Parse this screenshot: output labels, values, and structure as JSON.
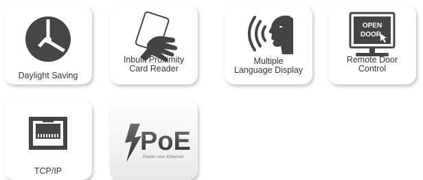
{
  "features": [
    {
      "label": "Daylight Saving",
      "icon": "clock-icon"
    },
    {
      "label": "Inbuilt Proximity\nCard Reader",
      "icon": "hand-card-icon"
    },
    {
      "label": "Multiple\nLanguage Display",
      "icon": "speaking-head-icon"
    },
    {
      "label": "Remote Door\nControl",
      "icon": "monitor-icon"
    },
    {
      "label": "TCP/IP",
      "icon": "ethernet-port-icon"
    },
    {
      "label": "",
      "icon": "poe-logo-icon"
    }
  ],
  "remote_screen_text": [
    "OPEN",
    "DOOR"
  ],
  "poe_logo": {
    "text": "PoE",
    "tagline": "Power over Ethernet"
  },
  "colors": {
    "icon": "#444444",
    "poe_gradient_top": "#6e6e6e",
    "poe_gradient_bottom": "#2e2e2e"
  }
}
